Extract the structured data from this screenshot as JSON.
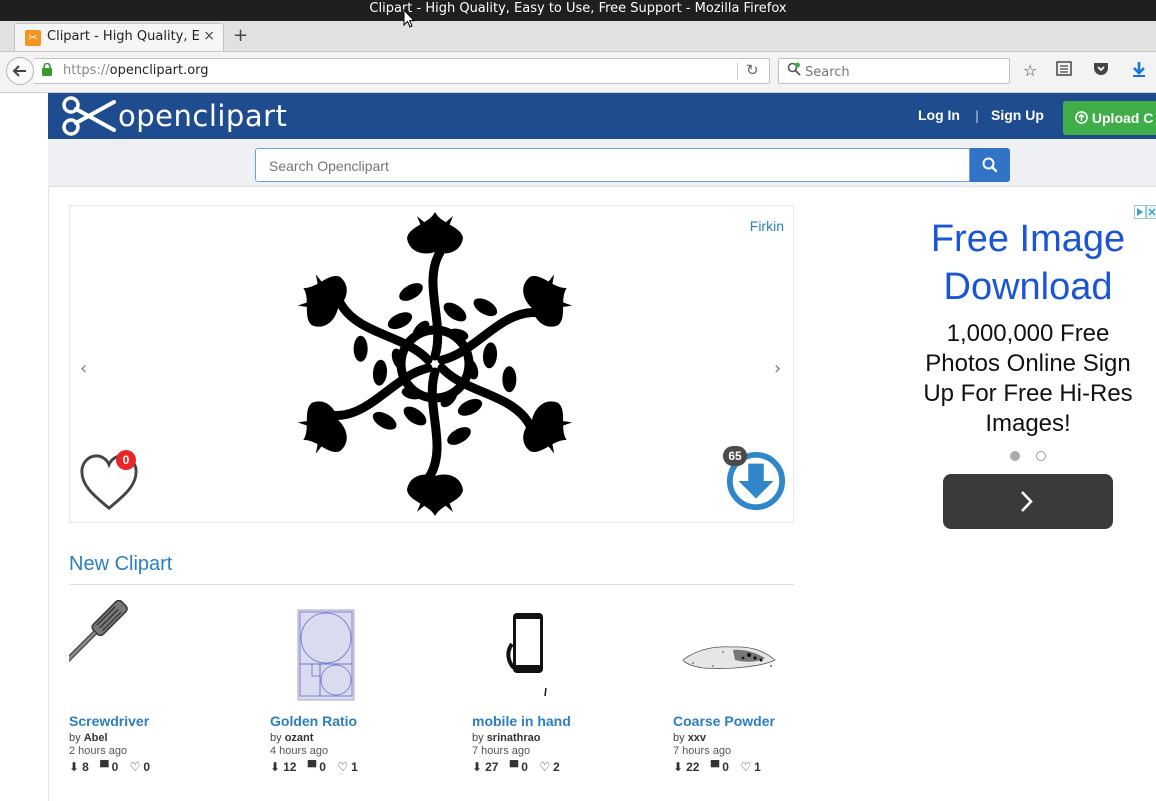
{
  "window": {
    "title": "Clipart - High Quality, Easy to Use, Free Support - Mozilla Firefox"
  },
  "browser": {
    "tab_title": "Clipart - High Quality, E...",
    "tab_close": "×",
    "new_tab": "+",
    "url_scheme": "https://",
    "url_host": "openclipart.org",
    "search_placeholder": "Search"
  },
  "site": {
    "logo_text": "openclipart",
    "login": "Log In",
    "divider": "|",
    "signup": "Sign Up",
    "upload": "Upload C",
    "search_placeholder": "Search Openclipart"
  },
  "featured": {
    "author": "Firkin",
    "favorites": "0",
    "downloads": "65"
  },
  "ad": {
    "headline": "Free Image Download",
    "body": "1,000,000 Free Photos Online Sign Up For Free Hi-Res Images!",
    "cta_glyph": ">"
  },
  "new_clipart": {
    "heading": "New Clipart",
    "items": [
      {
        "title": "Screwdriver",
        "by": "by",
        "author": "Abel",
        "time": "2 hours ago",
        "downloads": "8",
        "comments": "0",
        "favorites": "0"
      },
      {
        "title": "Golden Ratio",
        "by": "by",
        "author": "ozant",
        "time": "4 hours ago",
        "downloads": "12",
        "comments": "0",
        "favorites": "1"
      },
      {
        "title": "mobile in hand",
        "by": "by",
        "author": "srinathrao",
        "time": "7 hours ago",
        "downloads": "27",
        "comments": "0",
        "favorites": "2"
      },
      {
        "title": "Coarse Powder",
        "by": "by",
        "author": "xxv",
        "time": "7 hours ago",
        "downloads": "22",
        "comments": "0",
        "favorites": "1"
      }
    ]
  },
  "colors": {
    "header_blue": "#1e4c8e",
    "link_blue": "#2a7ec2",
    "upload_green": "#3fae49",
    "badge_red": "#e8262a",
    "download_blue": "#2f86c8"
  }
}
